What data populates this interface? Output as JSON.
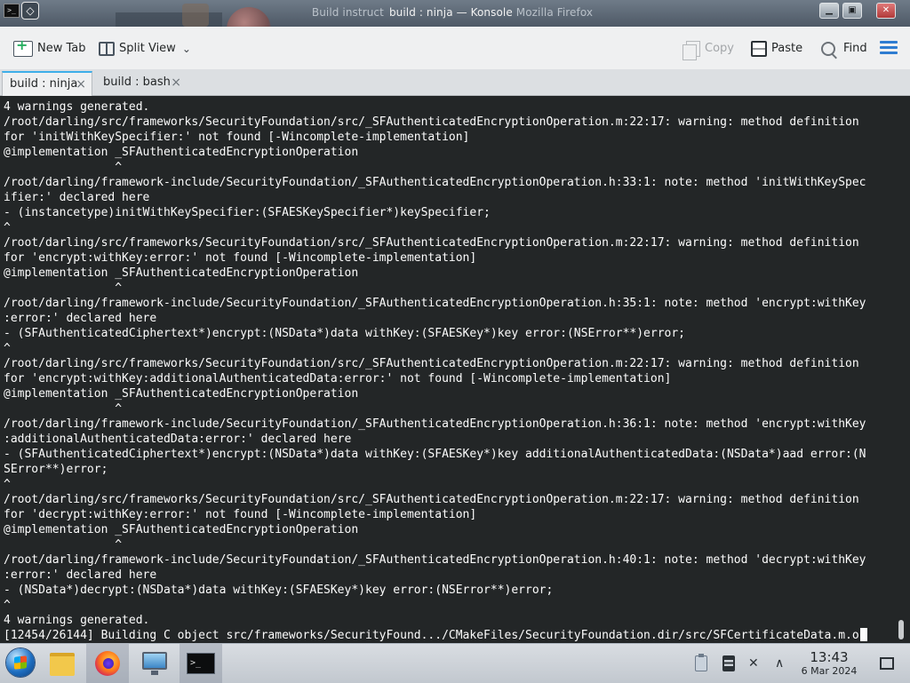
{
  "window": {
    "title_ghost": "Build instruct",
    "title": "build : ninja — Konsole",
    "title_tail": "Mozilla Firefox",
    "buttons": {
      "minimize": "▁",
      "maximize": "▣",
      "close": "✕"
    }
  },
  "toolbar": {
    "new_tab": "New Tab",
    "split_view": "Split View",
    "copy": "Copy",
    "paste": "Paste",
    "find": "Find",
    "icons": [
      "new-tab-icon",
      "split-view-icon",
      "copy-icon",
      "paste-icon",
      "search-icon",
      "hamburger-menu-icon"
    ]
  },
  "tabs": [
    {
      "label": "build : ninja",
      "active": true
    },
    {
      "label": "build : bash",
      "active": false
    }
  ],
  "terminal": {
    "lines": [
      "4 warnings generated.",
      "/root/darling/src/frameworks/SecurityFoundation/src/_SFAuthenticatedEncryptionOperation.m:22:17: warning: method definition",
      "for 'initWithKeySpecifier:' not found [-Wincomplete-implementation]",
      "@implementation _SFAuthenticatedEncryptionOperation",
      "                ^",
      "/root/darling/framework-include/SecurityFoundation/_SFAuthenticatedEncryptionOperation.h:33:1: note: method 'initWithKeySpec",
      "ifier:' declared here",
      "- (instancetype)initWithKeySpecifier:(SFAESKeySpecifier*)keySpecifier;",
      "^",
      "/root/darling/src/frameworks/SecurityFoundation/src/_SFAuthenticatedEncryptionOperation.m:22:17: warning: method definition",
      "for 'encrypt:withKey:error:' not found [-Wincomplete-implementation]",
      "@implementation _SFAuthenticatedEncryptionOperation",
      "                ^",
      "/root/darling/framework-include/SecurityFoundation/_SFAuthenticatedEncryptionOperation.h:35:1: note: method 'encrypt:withKey",
      ":error:' declared here",
      "- (SFAuthenticatedCiphertext*)encrypt:(NSData*)data withKey:(SFAESKey*)key error:(NSError**)error;",
      "^",
      "/root/darling/src/frameworks/SecurityFoundation/src/_SFAuthenticatedEncryptionOperation.m:22:17: warning: method definition",
      "for 'encrypt:withKey:additionalAuthenticatedData:error:' not found [-Wincomplete-implementation]",
      "@implementation _SFAuthenticatedEncryptionOperation",
      "                ^",
      "/root/darling/framework-include/SecurityFoundation/_SFAuthenticatedEncryptionOperation.h:36:1: note: method 'encrypt:withKey",
      ":additionalAuthenticatedData:error:' declared here",
      "- (SFAuthenticatedCiphertext*)encrypt:(NSData*)data withKey:(SFAESKey*)key additionalAuthenticatedData:(NSData*)aad error:(N",
      "SError**)error;",
      "^",
      "/root/darling/src/frameworks/SecurityFoundation/src/_SFAuthenticatedEncryptionOperation.m:22:17: warning: method definition",
      "for 'decrypt:withKey:error:' not found [-Wincomplete-implementation]",
      "@implementation _SFAuthenticatedEncryptionOperation",
      "                ^",
      "/root/darling/framework-include/SecurityFoundation/_SFAuthenticatedEncryptionOperation.h:40:1: note: method 'decrypt:withKey",
      ":error:' declared here",
      "- (NSData*)decrypt:(NSData*)data withKey:(SFAESKey*)key error:(NSError**)error;",
      "^",
      "4 warnings generated.",
      "[12454/26144] Building C object src/frameworks/SecurityFound.../CMakeFiles/SecurityFoundation.dir/src/SFCertificateData.m.o"
    ]
  },
  "taskbar": {
    "apps": [
      "start-menu",
      "file-manager",
      "firefox",
      "remote-desktop",
      "konsole"
    ],
    "konsole_icon_text": ">_",
    "tray_arrow": "∧",
    "mute_glyph": "🔇",
    "clock": {
      "time": "13:43",
      "date": "6 Mar 2024"
    }
  }
}
